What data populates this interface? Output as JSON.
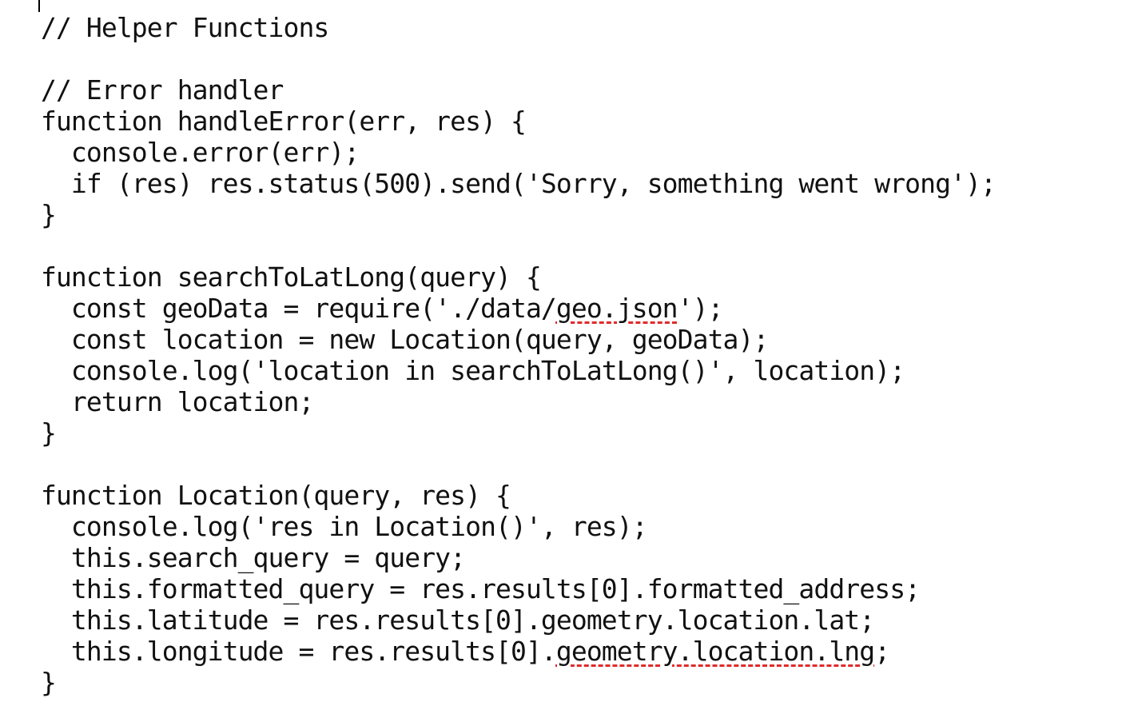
{
  "editor": {
    "spellcheck_color": "#e02b2b",
    "lines": [
      {
        "text": "// Helper Functions"
      },
      {
        "text": ""
      },
      {
        "text": "// Error handler"
      },
      {
        "text": "function handleError(err, res) {"
      },
      {
        "text": "  console.error(err);"
      },
      {
        "text": "  if (res) res.status(500).send('Sorry, something went wrong');"
      },
      {
        "text": "}"
      },
      {
        "text": ""
      },
      {
        "text": "function searchToLatLong(query) {"
      },
      {
        "pre": "  const geoData = require('./data/",
        "flag": "geo.json",
        "post": "');"
      },
      {
        "text": "  const location = new Location(query, geoData);"
      },
      {
        "text": "  console.log('location in searchToLatLong()', location);"
      },
      {
        "text": "  return location;"
      },
      {
        "text": "}"
      },
      {
        "text": ""
      },
      {
        "text": "function Location(query, res) {"
      },
      {
        "text": "  console.log('res in Location()', res);"
      },
      {
        "text": "  this.search_query = query;"
      },
      {
        "text": "  this.formatted_query = res.results[0].formatted_address;"
      },
      {
        "text": "  this.latitude = res.results[0].geometry.location.lat;"
      },
      {
        "pre": "  this.longitude = res.results[0].",
        "flag": "geometry.location.lng",
        "post": ";"
      },
      {
        "text": "}"
      }
    ]
  }
}
